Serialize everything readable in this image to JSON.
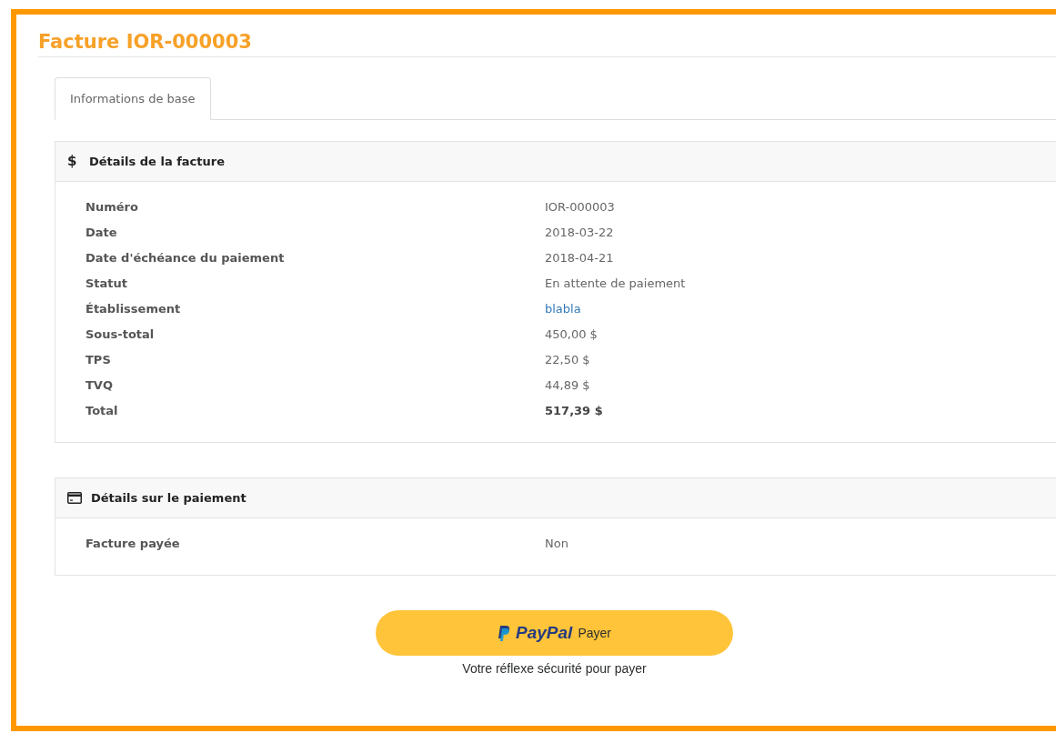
{
  "title": "Facture IOR-000003",
  "tabs": [
    {
      "label": "Informations de base",
      "selected": true
    }
  ],
  "panels": [
    {
      "kind": "glyph",
      "glyph": "$",
      "heading": "Détails de la facture",
      "rows": [
        {
          "label": "Numéro",
          "value": "IOR-000003",
          "kind": "plain"
        },
        {
          "label": "Date",
          "value": "2018-03-22",
          "kind": "plain"
        },
        {
          "label": "Date d'échéance du paiement",
          "value": "2018-04-21",
          "kind": "plain"
        },
        {
          "label": "Statut",
          "value": "En attente de paiement",
          "kind": "plain"
        },
        {
          "label": "Établissement",
          "value": "blabla",
          "kind": "link"
        },
        {
          "label": "Sous-total",
          "value": "450,00 $",
          "kind": "plain"
        },
        {
          "label": "TPS",
          "value": "22,50 $",
          "kind": "plain"
        },
        {
          "label": "TVQ",
          "value": "44,89 $",
          "kind": "plain"
        },
        {
          "label": "Total",
          "value": "517,39 $",
          "kind": "bold"
        }
      ]
    },
    {
      "kind": "card",
      "heading": "Détails sur le paiement",
      "rows": [
        {
          "label": "Facture payée",
          "value": "Non",
          "kind": "plain"
        }
      ]
    }
  ],
  "paypal": {
    "brand": "PayPal",
    "label": "Payer",
    "caption": "Votre réflexe sécurité pour payer"
  }
}
